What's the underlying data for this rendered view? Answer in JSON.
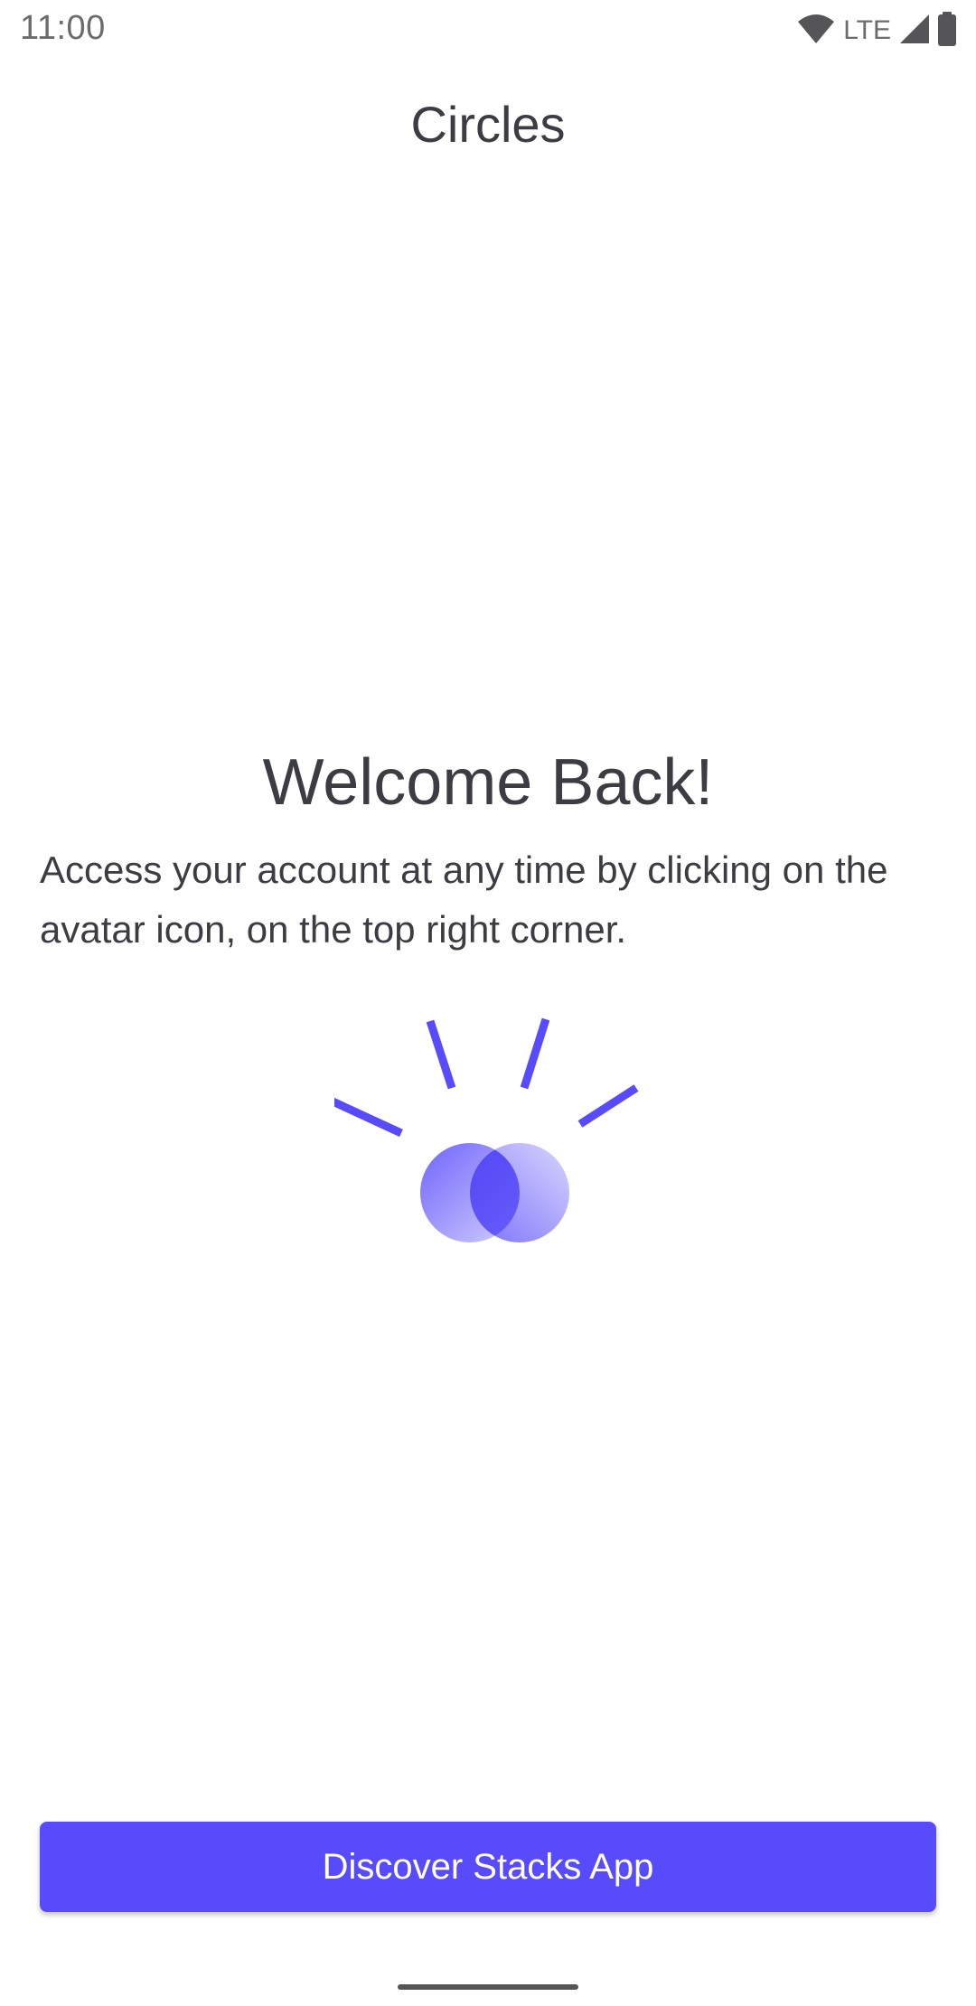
{
  "status_bar": {
    "time": "11:00",
    "network": "LTE",
    "icons": [
      "wifi-icon",
      "signal-icon",
      "battery-icon"
    ]
  },
  "header": {
    "title": "Circles"
  },
  "main": {
    "heading": "Welcome Back!",
    "body": "Access your account at any time by clicking on the avatar icon, on the top right corner.",
    "illustration_icon": "overlapping-circles-icon"
  },
  "actions": {
    "primary_label": "Discover Stacks App"
  },
  "colors": {
    "accent": "#574bfb",
    "text": "#3c3c43",
    "background": "#ffffff"
  }
}
